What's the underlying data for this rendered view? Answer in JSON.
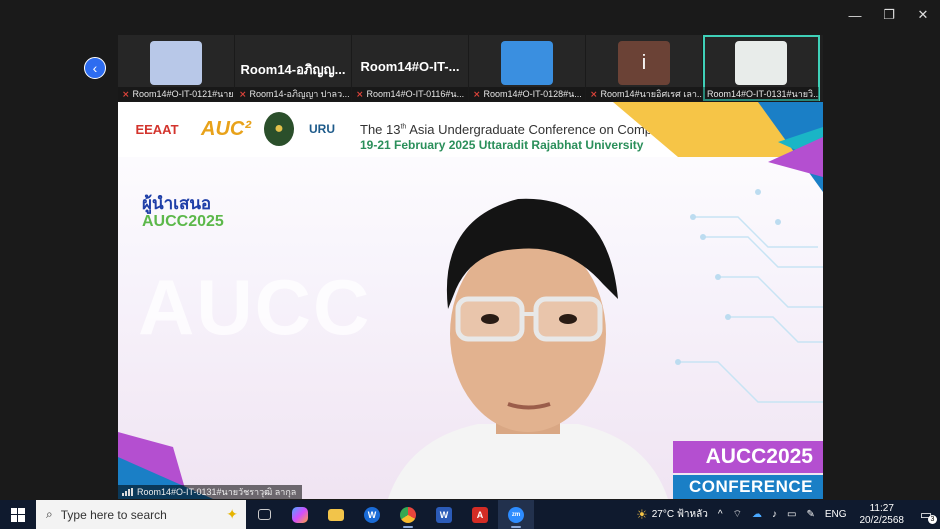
{
  "window": {
    "minimize": "—",
    "restore": "❐",
    "close": "✕"
  },
  "thumbnails": [
    {
      "name": "Room14#O-IT-0121#นาย...",
      "big": "",
      "has_avatar": true,
      "avatar_color": "#b8c8e8",
      "muted": true
    },
    {
      "name": "Room14-อภิญญา ปาลว...",
      "big": "Room14-อภิญญ...",
      "has_avatar": false,
      "muted": true
    },
    {
      "name": "Room14#O-IT-0116#น...",
      "big": "Room14#O-IT-...",
      "has_avatar": false,
      "muted": true
    },
    {
      "name": "Room14#O-IT-0128#น...",
      "big": "",
      "has_avatar": true,
      "avatar_color": "#3a8fe0",
      "muted": true
    },
    {
      "name": "Room14#นายอิศเรศ เลา...",
      "big": "i",
      "has_avatar": true,
      "avatar_color": "#6b4236",
      "muted": true
    },
    {
      "name": "Room14#O-IT-0131#นายวิ...",
      "big": "",
      "has_avatar": true,
      "avatar_color": "#e8ecea",
      "muted": false,
      "active": true
    }
  ],
  "slide": {
    "logos": [
      "EEAAT",
      "AUC²",
      "●",
      "URU"
    ],
    "conf_prefix": "The 13",
    "conf_sup": "th",
    "conf_suffix": " Asia Undergraduate Conference on Computing",
    "conf_date": "19-21 February 2025  Uttaradit Rajabhat University",
    "presenter_label": "ผู้นำเสนอ",
    "event": "AUCC2025",
    "watermark": "AUCC",
    "badge_top": "AUCC2025",
    "badge_bottom": "CONFERENCE"
  },
  "main_label": "Room14#O-IT-0131#นายวัชราวุฒิ ลากุล",
  "taskbar": {
    "search_placeholder": "Type here to search",
    "weather": "27°C  ฟ้าหลัว",
    "lang": "ENG",
    "time": "11:27",
    "date": "20/2/2568",
    "notif_count": "3"
  },
  "colors": {
    "accent_blue": "#2d6cf0",
    "active_outline": "#3fd0b8",
    "badge_purple": "#b44fd0",
    "badge_blue": "#1a7fc6"
  }
}
